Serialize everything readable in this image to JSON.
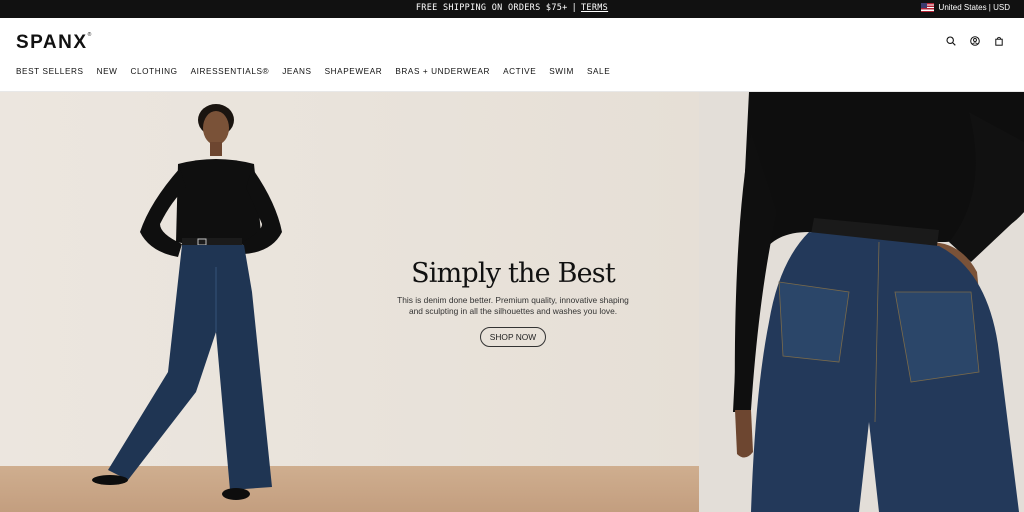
{
  "announcement": {
    "text": "FREE SHIPPING ON ORDERS $75+",
    "separator": "|",
    "terms_label": "TERMS"
  },
  "locale": {
    "label": "United States | USD",
    "flag_icon": "us-flag-icon"
  },
  "header": {
    "logo": "SPANX",
    "logo_mark": "®",
    "icons": [
      "search-icon",
      "account-icon",
      "bag-icon"
    ]
  },
  "nav": {
    "items": [
      "BEST SELLERS",
      "NEW",
      "CLOTHING",
      "AIRESSENTIALS®",
      "JEANS",
      "SHAPEWEAR",
      "BRAS + UNDERWEAR",
      "ACTIVE",
      "SWIM",
      "SALE"
    ]
  },
  "hero": {
    "title": "Simply the Best",
    "subtitle_line1": "This is denim done better. Premium quality, innovative shaping",
    "subtitle_line2": "and sculpting in all the silhouettes and washes you love.",
    "cta_label": "SHOP NOW"
  },
  "colors": {
    "topbar": "#111111",
    "denim": "#1f3553",
    "top": "#101010",
    "wall": "#e9e3db",
    "floor": "#c9a585"
  }
}
